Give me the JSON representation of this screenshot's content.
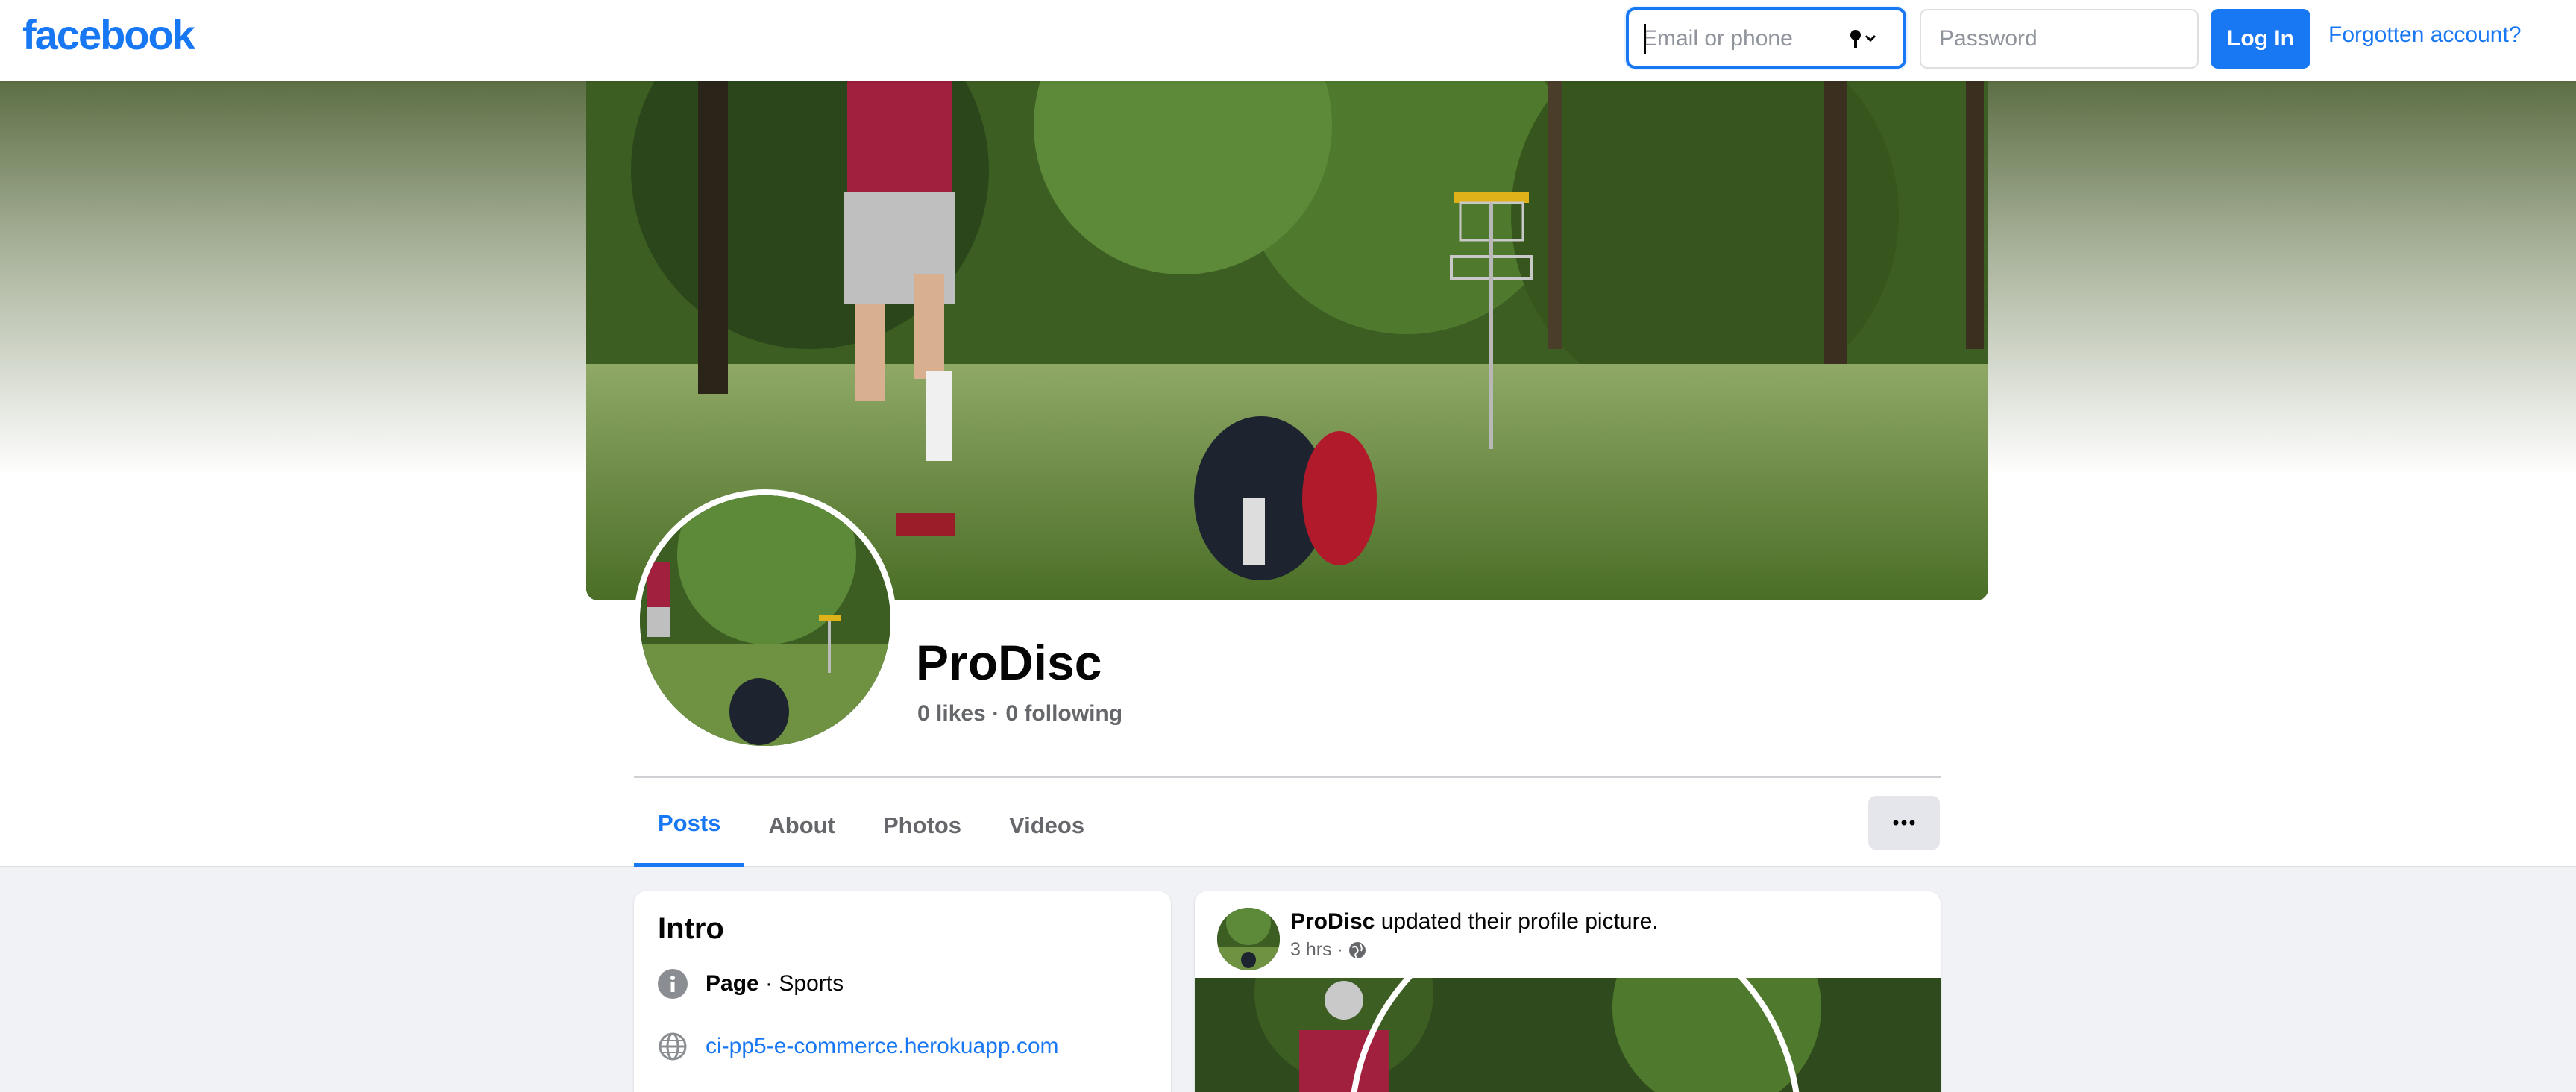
{
  "topbar": {
    "logo": "facebook",
    "email_placeholder": "Email or phone",
    "password_placeholder": "Password",
    "login_label": "Log In",
    "forgot_label": "Forgotten account?"
  },
  "profile": {
    "name": "ProDisc",
    "stats": "0 likes · 0 following"
  },
  "tabs": [
    {
      "label": "Posts",
      "active": true
    },
    {
      "label": "About",
      "active": false
    },
    {
      "label": "Photos",
      "active": false
    },
    {
      "label": "Videos",
      "active": false
    }
  ],
  "intro": {
    "title": "Intro",
    "category_bold": "Page",
    "category_rest": " · Sports",
    "website": "ci-pp5-e-commerce.herokuapp.com"
  },
  "post": {
    "author": "ProDisc",
    "action": " updated their profile picture.",
    "time": "3 hrs ·"
  },
  "icons": {
    "password_manager": "key-icon",
    "more": "more-horizontal-icon",
    "info": "info-icon",
    "website": "globe-icon",
    "audience": "public-globe-icon"
  },
  "colors": {
    "brand": "#1877f2",
    "background": "#f0f2f5",
    "secondary_text": "#65676b"
  }
}
